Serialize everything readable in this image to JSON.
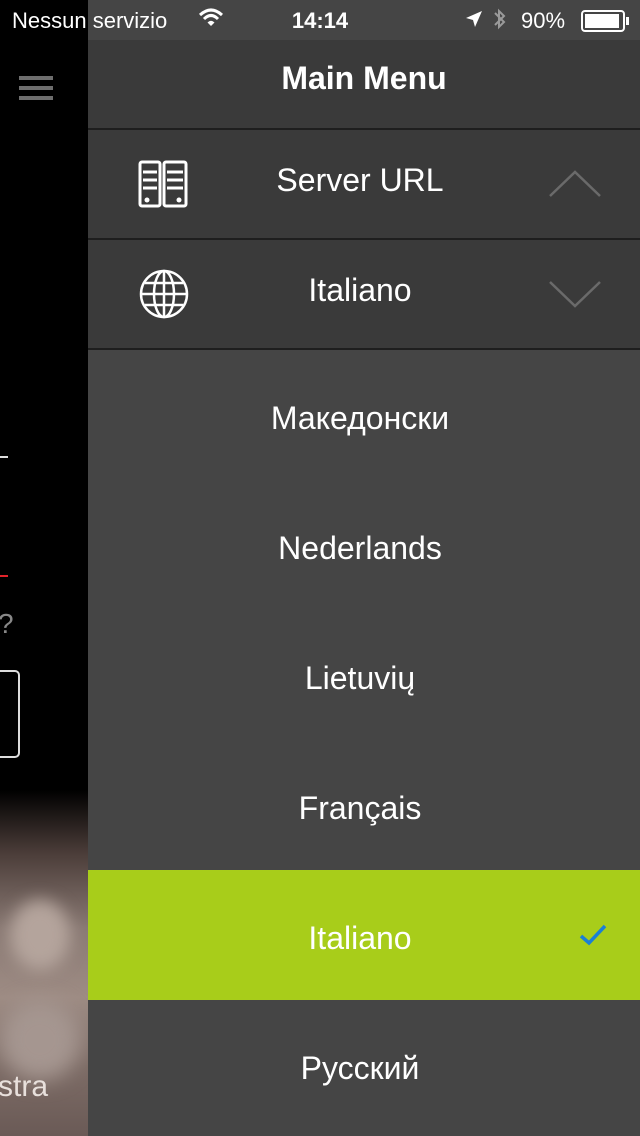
{
  "status_bar": {
    "carrier": "Nessun servizio",
    "time": "14:14",
    "battery_percent": "90%",
    "icons": [
      "wifi-icon",
      "location-arrow-icon",
      "bluetooth-icon",
      "battery-icon"
    ]
  },
  "background_app": {
    "question_mark": "?",
    "partial_text": "stra",
    "accent_color": "#e2232a"
  },
  "menu": {
    "title": "Main Menu",
    "rows": [
      {
        "label": "Server URL",
        "icon": "server-icon",
        "chevron": "chevron-up-icon"
      },
      {
        "label": "Italiano",
        "icon": "globe-icon",
        "chevron": "chevron-down-icon"
      }
    ],
    "languages": [
      {
        "label": "Македонски",
        "selected": false
      },
      {
        "label": "Nederlands",
        "selected": false
      },
      {
        "label": "Lietuvių",
        "selected": false
      },
      {
        "label": "Français",
        "selected": false
      },
      {
        "label": "Italiano",
        "selected": true
      },
      {
        "label": "Русский",
        "selected": false
      }
    ],
    "selected_color": "#a8cd1a",
    "check_color": "#1a7fd6"
  }
}
